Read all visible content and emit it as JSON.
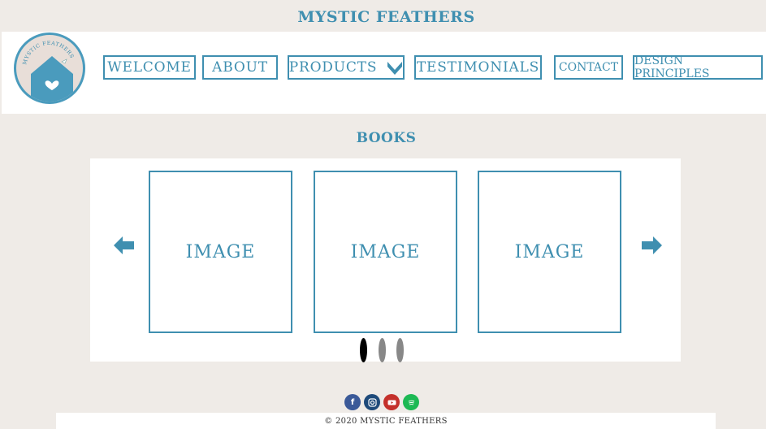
{
  "header": {
    "title": "MYSTIC FEATHERS"
  },
  "logo": {
    "ring_text": "MYSTIC FEATHERS"
  },
  "nav": {
    "welcome": "WELCOME",
    "about": "ABOUT",
    "products": "PRODUCTS",
    "testimonials": "TESTIMONIALS",
    "contact": "CONTACT",
    "design_principles": "DESIGN PRINCIPLES"
  },
  "section": {
    "title": "BOOKS"
  },
  "carousel": {
    "items": [
      "IMAGE",
      "IMAGE",
      "IMAGE"
    ],
    "active_index": 0
  },
  "socials": [
    "facebook-icon",
    "instagram-icon",
    "youtube-icon",
    "spotify-icon"
  ],
  "footer": {
    "copyright": "© 2020 MYSTIC FEATHERS"
  },
  "colors": {
    "accent": "#3f8fb0",
    "background": "#efebe7"
  }
}
